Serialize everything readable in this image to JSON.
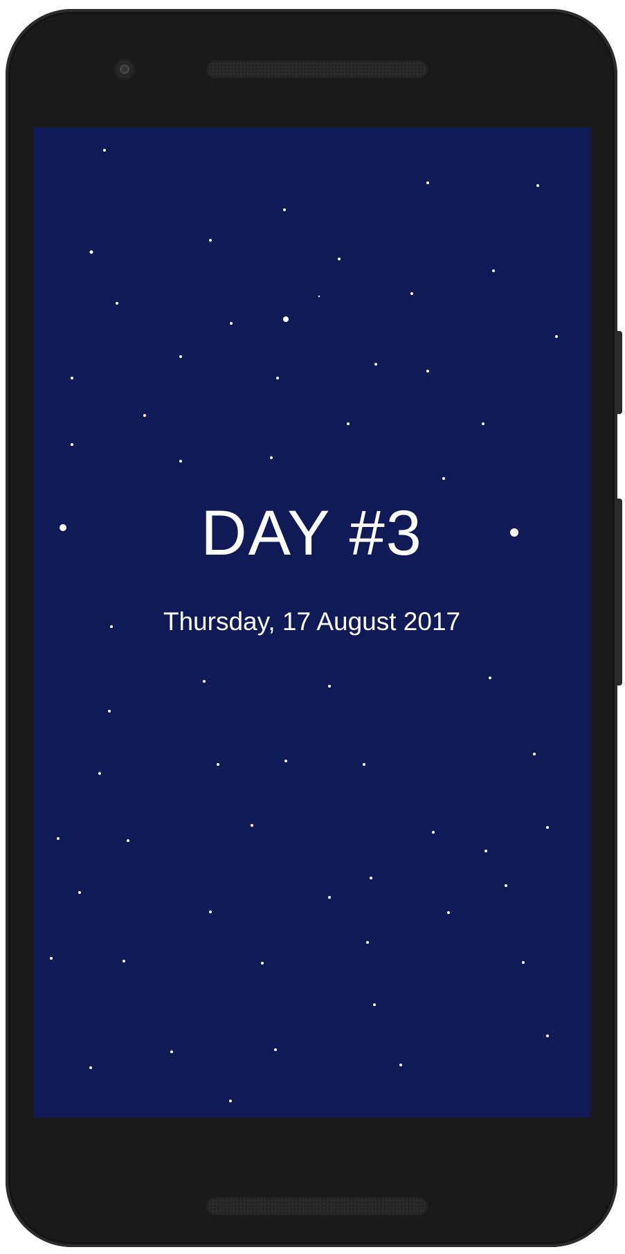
{
  "screen": {
    "day_title": "DAY #3",
    "date": "Thursday, 17 August 2017"
  },
  "colors": {
    "background": "#0f1a56",
    "text": "#ffffff",
    "star": "#ffffff",
    "device_body": "#1a1a1a"
  },
  "icons": {
    "camera": "front-camera-icon",
    "speaker": "speaker-grille-icon"
  }
}
